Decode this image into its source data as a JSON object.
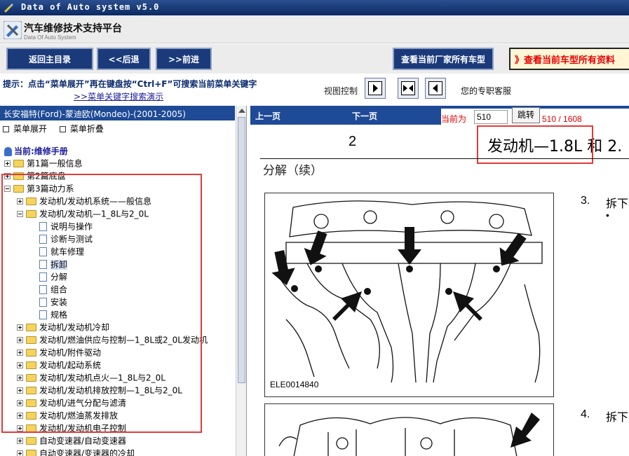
{
  "window": {
    "title": "Data of Auto system v5.0"
  },
  "brand": {
    "title": "汽车维修技术支持平台",
    "subtitle": "Data Of Auto System"
  },
  "nav": {
    "home": "返回主目录",
    "back": "<<后退",
    "forward": ">>前进",
    "all_models": "查看当前厂家所有车型",
    "current_model": "》查看当前车型所有资料"
  },
  "hint": {
    "text": "提示：点击“菜单展开”再在键盘按“Ctrl+F”可搜索当前菜单关键字",
    "link": ">>菜单关键字搜索演示"
  },
  "view_control": {
    "label": "视图控制"
  },
  "service": {
    "text": "您的专职客服"
  },
  "tree": {
    "header": "长安福特(Ford)-蒙迪欧(Mondeo)-(2001-2005)",
    "expand": "菜单展开",
    "collapse": "菜单折叠",
    "current": "当前:维修手册",
    "items": [
      {
        "label": "第1篇一般信息"
      },
      {
        "label": "第2篇底盘"
      },
      {
        "label": "第3篇动力系"
      },
      {
        "label": "发动机/发动机系统——般信息"
      },
      {
        "label": "发动机/发动机—1_8L与2_0L"
      },
      {
        "label": "说明与操作"
      },
      {
        "label": "诊断与测试"
      },
      {
        "label": "就车修理"
      },
      {
        "label": "拆卸"
      },
      {
        "label": "分解"
      },
      {
        "label": "组合"
      },
      {
        "label": "安装"
      },
      {
        "label": "规格"
      },
      {
        "label": "发动机/发动机冷却"
      },
      {
        "label": "发动机/燃油供应与控制—1_8L或2_0L发动机"
      },
      {
        "label": "发动机/附件驱动"
      },
      {
        "label": "发动机/起动系统"
      },
      {
        "label": "发动机/发动机点火—1_8L与2_0L"
      },
      {
        "label": "发动机/发动机排放控制—1_8L与2_0L"
      },
      {
        "label": "发动机/进气分配与滤清"
      },
      {
        "label": "发动机/燃油蒸发排放"
      },
      {
        "label": "发动机/发动机电子控制"
      },
      {
        "label": "自动变速器/自动变速器"
      },
      {
        "label": "自动变速器/变速器的冷却"
      }
    ]
  },
  "doc": {
    "prev": "上一页",
    "next": "下一页",
    "current_label": "当前为",
    "page_value": "510",
    "goto": "跳转",
    "page_count": "510 / 1608",
    "page_number": "2",
    "title": "发动机—1.8L 和 2.",
    "subtitle": "分解（续）",
    "figure1_label": "ELE0014840",
    "step3_num": "3.",
    "step3_text": "拆下",
    "step3_bullet": "•",
    "step4_num": "4.",
    "step4_text": "拆下"
  },
  "colors": {
    "nav_blue": "#1a3a7a",
    "header_blue": "#1e4a96",
    "highlight_red": "#e23a3a"
  }
}
